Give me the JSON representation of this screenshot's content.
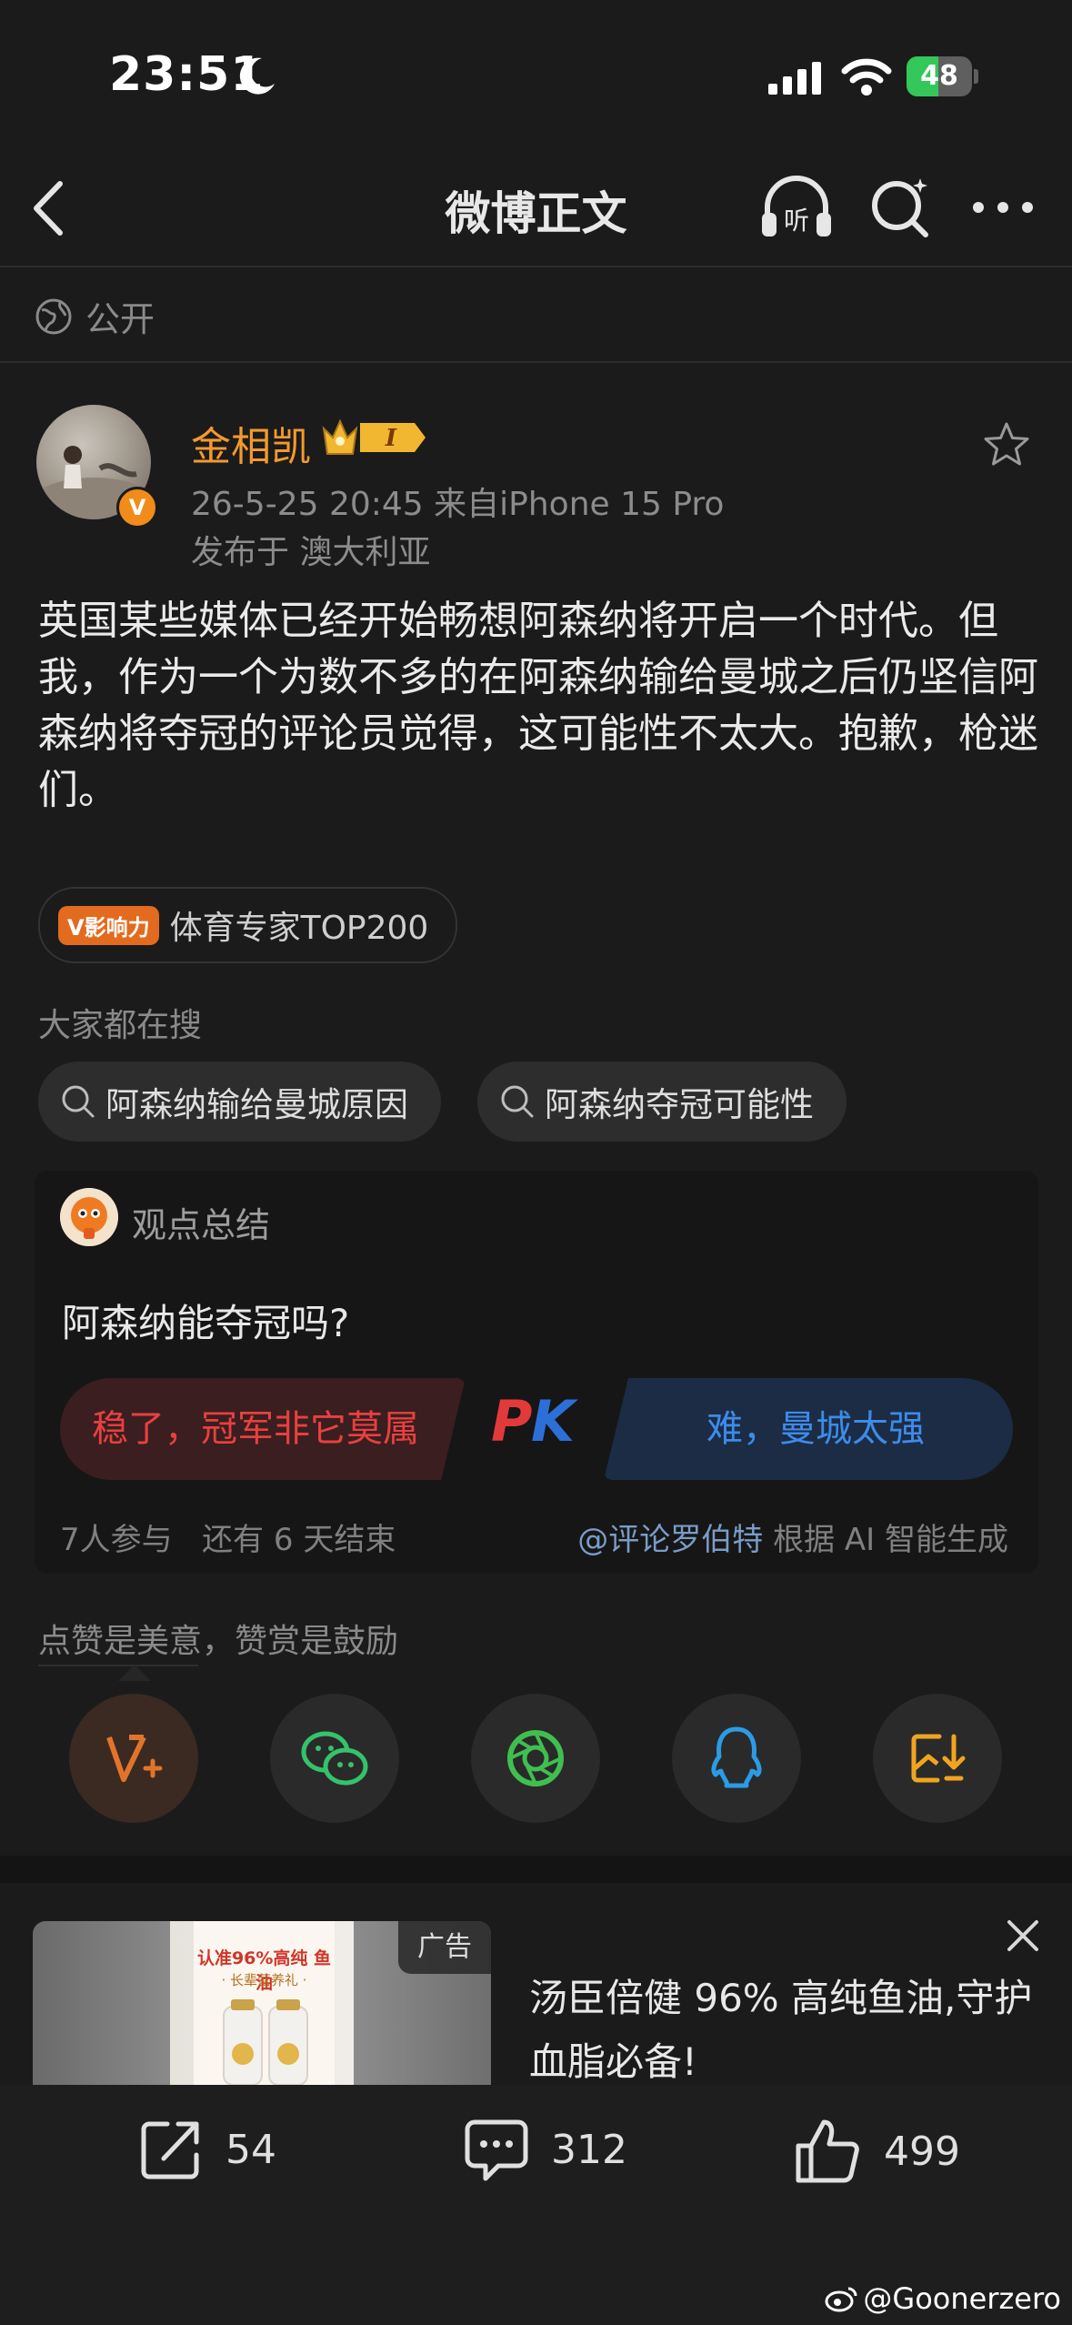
{
  "status_bar": {
    "time": "23:51",
    "battery": "48",
    "battery_level": 0.48
  },
  "nav": {
    "title": "微博正文"
  },
  "visibility": {
    "label": "公开"
  },
  "author": {
    "name": "金相凯",
    "level": "I",
    "verified": "V",
    "meta": "26-5-25 20:45  来自iPhone 15 Pro",
    "location": "发布于 澳大利亚"
  },
  "post": {
    "text": "英国某些媒体已经开始畅想阿森纳将开启一个时代。但我，作为一个为数不多的在阿森纳输给曼城之后仍坚信阿森纳将夺冠的评论员觉得，这可能性不太大。抱歉，枪迷们。"
  },
  "influence": {
    "tag": "V影响力",
    "label": "体育专家TOP200"
  },
  "hot_search": {
    "label": "大家都在搜",
    "chips": [
      "阿森纳输给曼城原因",
      "阿森纳夺冠可能性"
    ]
  },
  "opinion": {
    "header": "观点总结",
    "question": "阿森纳能夺冠吗?",
    "option_a": "稳了，冠军非它莫属",
    "pk": "PK",
    "option_b": "难，曼城太强",
    "participants": "7人参与",
    "remaining": "还有 6 天结束",
    "source_link": "@评论罗伯特",
    "source_suffix": " 根据 AI 智能生成"
  },
  "reward": {
    "label": "点赞是美意，赞赏是鼓励"
  },
  "share_targets": [
    "weibo-reward-icon",
    "wechat-icon",
    "moments-icon",
    "qq-icon",
    "save-image-icon"
  ],
  "ad": {
    "tag": "广告",
    "title": "汤臣倍健 96% 高纯鱼油,守护血脂必备!",
    "product_line1": "认准96%高纯 鱼油",
    "product_line2": "· 长辈营养礼 ·"
  },
  "bottom_bar": {
    "reposts": "54",
    "comments": "312",
    "likes": "499"
  },
  "watermark": "@Goonerzero",
  "colors": {
    "accent_orange": "#f39a2d",
    "pk_red": "#e8403f",
    "pk_blue": "#3d8bea",
    "background": "#1b1b1b"
  }
}
